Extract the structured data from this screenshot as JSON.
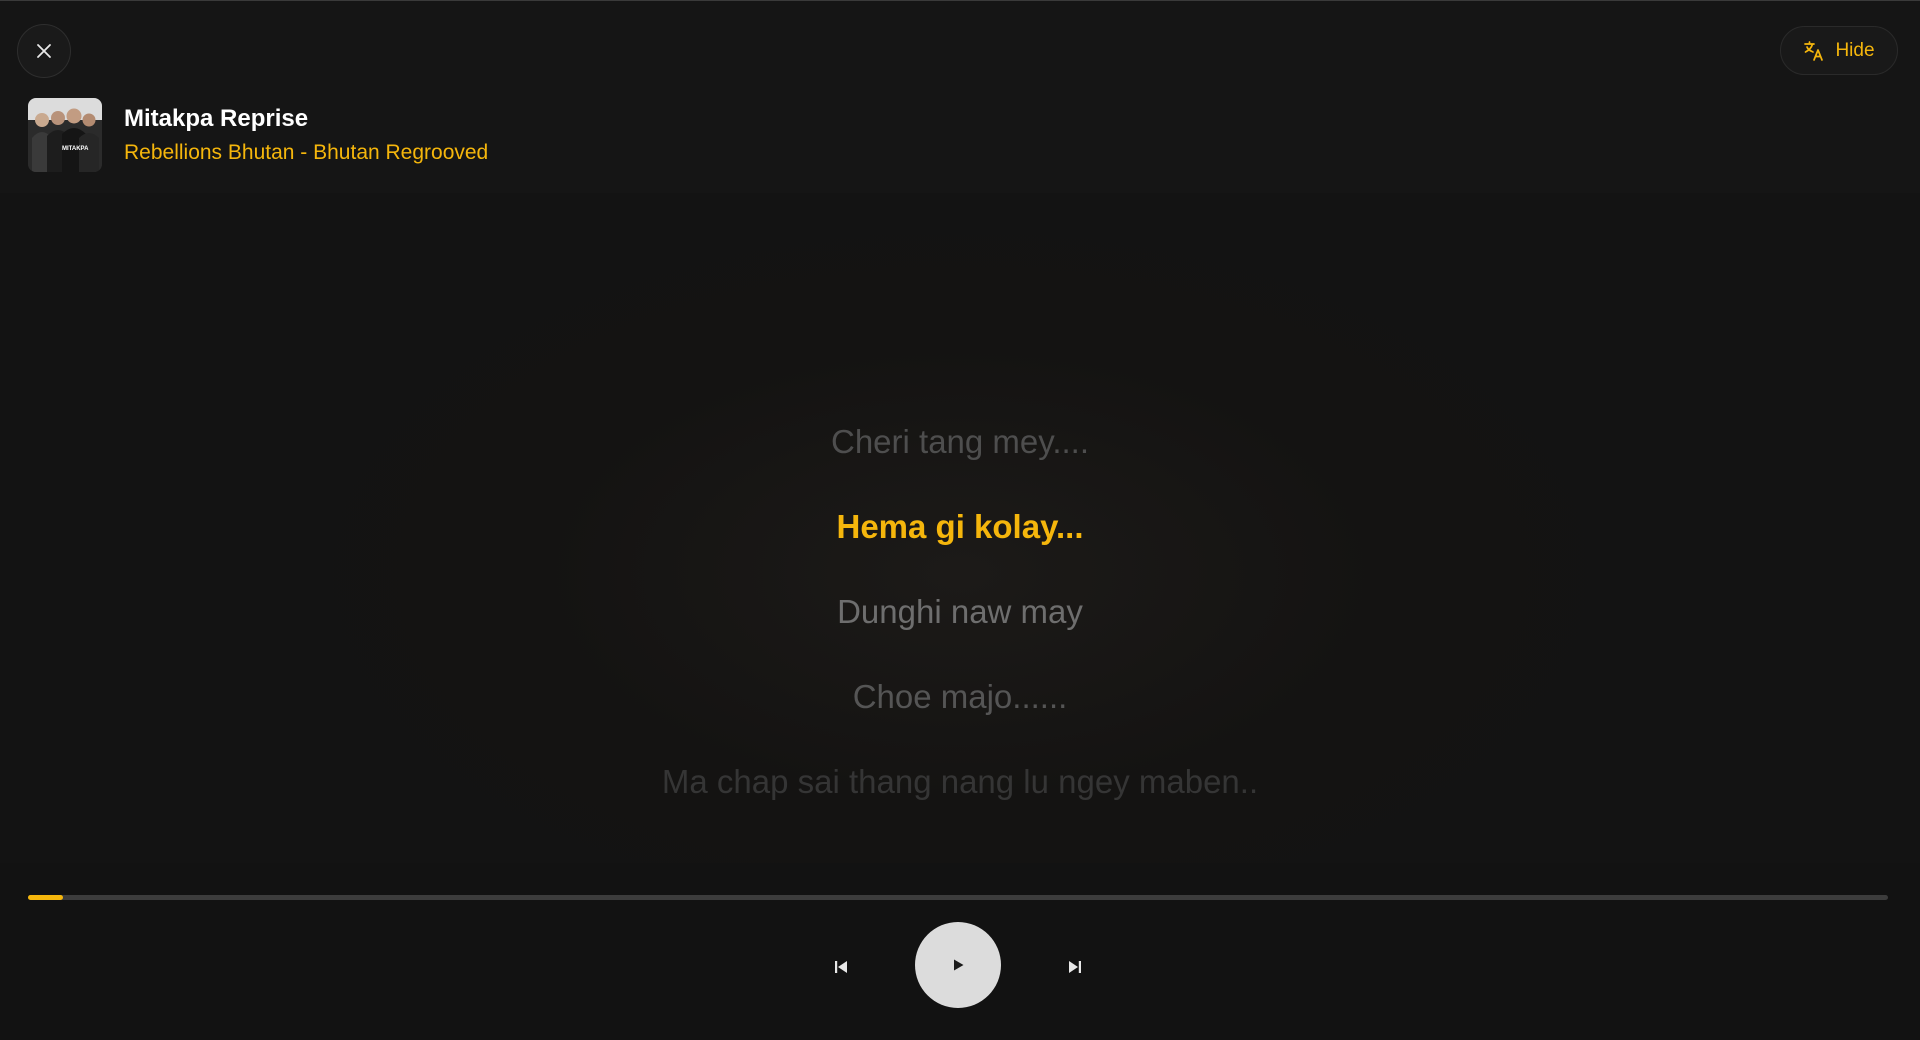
{
  "header": {
    "close_icon": "close-icon",
    "hide_label": "Hide",
    "hide_icon": "translate-icon"
  },
  "track": {
    "title": "Mitakpa Reprise",
    "subtitle": "Rebellions Bhutan - Bhutan Regrooved",
    "cover_text": "MITAKPA"
  },
  "lyrics": [
    "Cheri tang mey....",
    "Hema gi kolay...",
    "Dunghi naw may",
    "Choe majo......",
    "Ma chap sai thang nang lu ngey maben.."
  ],
  "player": {
    "progress_fraction": 0.019,
    "prev_icon": "skip-previous-icon",
    "play_icon": "play-icon",
    "next_icon": "skip-next-icon"
  },
  "colors": {
    "accent": "#f5b60c",
    "background": "#141414"
  }
}
